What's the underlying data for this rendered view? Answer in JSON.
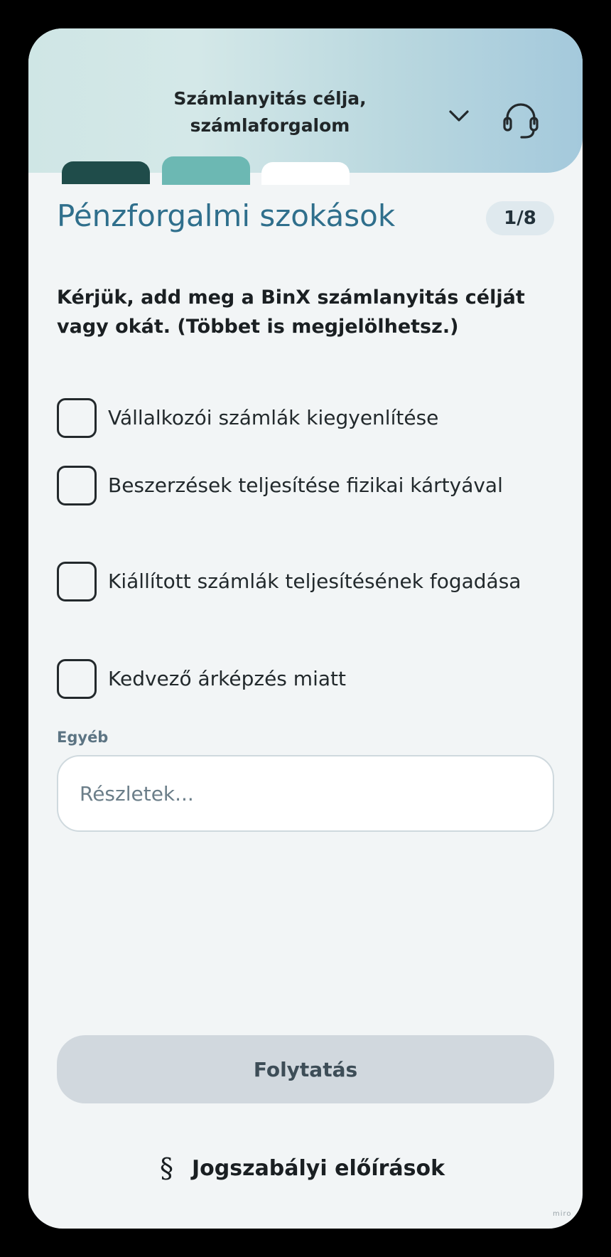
{
  "header": {
    "title_line1": "Számlanyitás célja,",
    "title_line2": "számlaforgalom",
    "chevron_icon": "chevron-down-icon",
    "support_icon": "headset-icon"
  },
  "progress_tabs": {
    "colors": [
      "#1f4c4a",
      "#6cb8b3",
      "#ffffff"
    ]
  },
  "section": {
    "title": "Pénzforgalmi szokások",
    "step": "1/8"
  },
  "question": "Kérjük, add meg a BinX számlanyitás célját vagy okát. (Többet is megjelölhetsz.)",
  "options": [
    {
      "label": "Vállalkozói számlák kiegyenlítése",
      "checked": false
    },
    {
      "label": "Beszerzések teljesítése fizikai kártyával",
      "checked": false
    },
    {
      "label": "Kiállított számlák teljesítésének fogadása",
      "checked": false
    },
    {
      "label": "Kedvező árképzés miatt",
      "checked": false
    }
  ],
  "other": {
    "label": "Egyéb",
    "value": "",
    "placeholder": "Részletek..."
  },
  "continue_button": {
    "label": "Folytatás",
    "enabled": false
  },
  "legal": {
    "icon": "§",
    "label": "Jogszabályi előírások"
  },
  "watermark": "miro",
  "colors": {
    "title_blue": "#2f6f8c",
    "button_disabled_bg": "#d1d8de",
    "background": "#f2f5f6"
  }
}
